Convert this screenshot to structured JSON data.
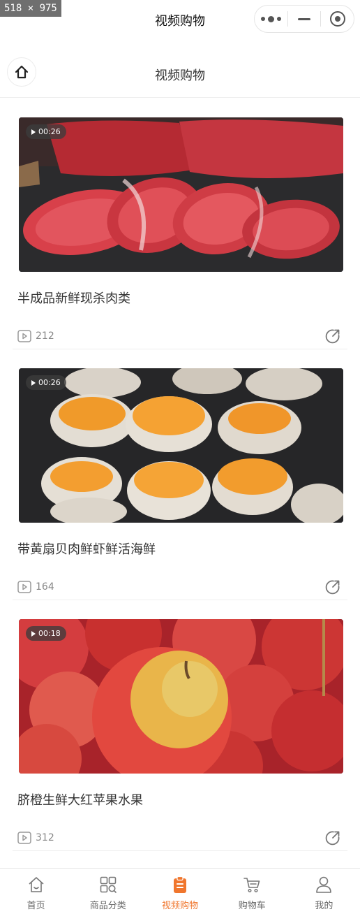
{
  "overlay": {
    "dimensions_label": "518 × 975"
  },
  "top_bar": {
    "title": "视频购物"
  },
  "nav": {
    "title": "视频购物"
  },
  "videos": [
    {
      "duration": "00:26",
      "title": "半成品新鲜现杀肉类",
      "views": "212",
      "thumb": "meat"
    },
    {
      "duration": "00:26",
      "title": "带黄扇贝肉鲜虾鲜活海鲜",
      "views": "164",
      "thumb": "scallops"
    },
    {
      "duration": "00:18",
      "title": "脐橙生鲜大红苹果水果",
      "views": "312",
      "thumb": "apples"
    }
  ],
  "tabs": [
    {
      "label": "首页",
      "icon": "home-icon",
      "active": false
    },
    {
      "label": "商品分类",
      "icon": "category-grid-icon",
      "active": false
    },
    {
      "label": "视频购物",
      "icon": "video-clipboard-icon",
      "active": true
    },
    {
      "label": "购物车",
      "icon": "cart-icon",
      "active": false
    },
    {
      "label": "我的",
      "icon": "user-icon",
      "active": false
    }
  ],
  "colors": {
    "accent": "#f0762d",
    "text": "#333333",
    "muted": "#888888"
  }
}
